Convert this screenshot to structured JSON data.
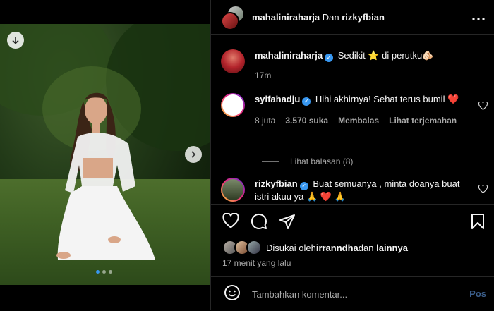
{
  "header": {
    "user1": "mahaliniraharja",
    "connector": "Dan",
    "user2": "rizkyfbian",
    "more_icon": "more-horizontal-icon"
  },
  "caption": {
    "username": "mahaliniraharja",
    "text": "Sedikit ⭐ di perutku🫵🏻",
    "time": "17m"
  },
  "comments": [
    {
      "username": "syifahadju",
      "text": "Hihi akhirnya! Sehat terus bumil ❤️",
      "time": "8 juta",
      "likes": "3.570 suka",
      "reply_label": "Membalas",
      "translate_label": "Lihat terjemahan",
      "view_replies": "Lihat balasan (8)"
    },
    {
      "username": "rizkyfbian",
      "text": "Buat semuanya , minta doanya buat istri akuu ya 🙏 ❤️ 🙏"
    }
  ],
  "likes": {
    "prefix": "Disukai oleh",
    "user": "irranndha",
    "connector": "dan",
    "suffix": "lainnya"
  },
  "post_time": "17 menit yang lalu",
  "comment_box": {
    "placeholder": "Tambahkan komentar...",
    "post_label": "Pos"
  },
  "colors": {
    "accent": "#3897f0",
    "background": "#000000",
    "muted": "#a8a8a8",
    "heart": "#ed4956"
  }
}
